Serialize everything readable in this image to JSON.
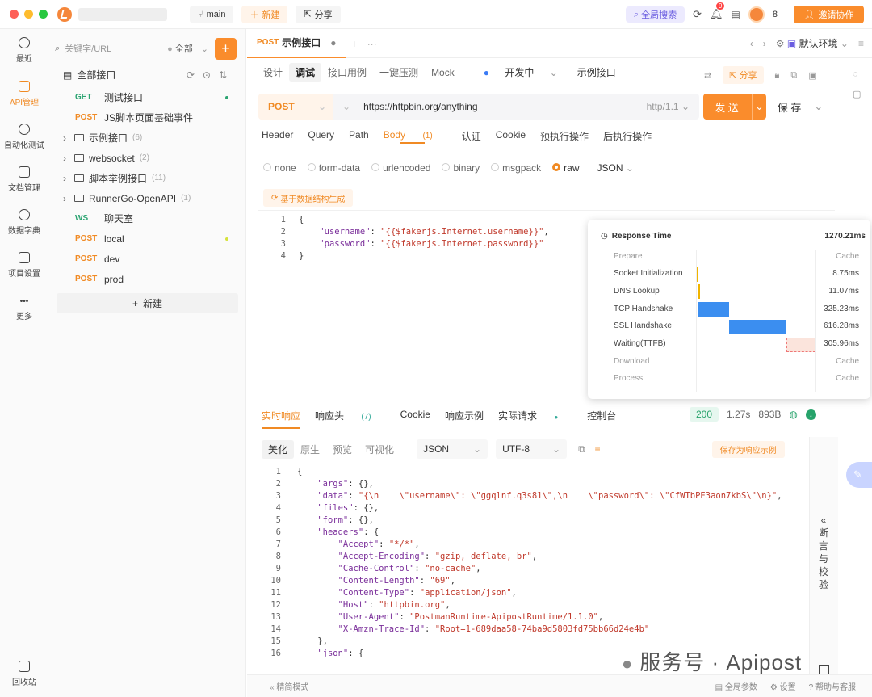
{
  "topbar": {
    "branch": "main",
    "new": "新建",
    "share": "分享",
    "global_search": "全局搜索",
    "notif_count": "9",
    "member_count": "8",
    "invite": "邀请协作"
  },
  "rail": [
    {
      "label": "最近",
      "icon": "clock-icon"
    },
    {
      "label": "API管理",
      "icon": "api-icon"
    },
    {
      "label": "自动化测试",
      "icon": "automation-icon"
    },
    {
      "label": "文档管理",
      "icon": "doc-icon"
    },
    {
      "label": "数据字典",
      "icon": "dictionary-icon"
    },
    {
      "label": "项目设置",
      "icon": "settings-icon"
    },
    {
      "label": "更多",
      "icon": "more-icon"
    },
    {
      "label": "回收站",
      "icon": "trash-icon"
    }
  ],
  "tree": {
    "search_placeholder": "关键字/URL",
    "filter": "全部",
    "root": "全部接口",
    "add": "新建",
    "items": [
      {
        "method": "GET",
        "name": "测试接口"
      },
      {
        "method": "POST",
        "name": "JS脚本页面基础事件"
      },
      {
        "folder": true,
        "name": "示例接口",
        "count": "(6)"
      },
      {
        "folder": true,
        "name": "websocket",
        "count": "(2)"
      },
      {
        "folder": true,
        "name": "脚本举例接口",
        "count": "(11)"
      },
      {
        "folder": true,
        "name": "RunnerGo-OpenAPI",
        "count": "(1)"
      },
      {
        "method": "WS",
        "name": "聊天室"
      },
      {
        "method": "POST",
        "name": "local"
      },
      {
        "method": "POST",
        "name": "dev"
      },
      {
        "method": "POST",
        "name": "prod"
      }
    ]
  },
  "tab": {
    "method": "POST",
    "title": "示例接口",
    "env": "默认环境"
  },
  "subtabs": [
    "设计",
    "调试",
    "接口用例",
    "一键压测",
    "Mock"
  ],
  "status": "开发中",
  "api_name": "示例接口",
  "share": "分享",
  "request": {
    "method": "POST",
    "url": "https://httpbin.org/anything",
    "protocol": "http/1.1",
    "send": "发 送",
    "save": "保 存"
  },
  "param_tabs": [
    "Header",
    "Query",
    "Path",
    "Body",
    "认证",
    "Cookie",
    "预执行操作",
    "后执行操作"
  ],
  "body_count": "(1)",
  "body_types": [
    "none",
    "form-data",
    "urlencoded",
    "binary",
    "msgpack",
    "raw"
  ],
  "raw_format": "JSON",
  "gen_label": "基于数据结构生成",
  "body_lines": [
    "{",
    "    \"username\": \"{{$fakerjs.Internet.username}}\",",
    "    \"password\": \"{{$fakerjs.Internet.password}}\"",
    "}"
  ],
  "response_time": {
    "title": "Response Time",
    "total": "1270.21ms",
    "rows": [
      {
        "label": "Prepare",
        "value": "Cache"
      },
      {
        "label": "Socket Initialization",
        "value": "8.75ms"
      },
      {
        "label": "DNS Lookup",
        "value": "11.07ms"
      },
      {
        "label": "TCP Handshake",
        "value": "325.23ms"
      },
      {
        "label": "SSL Handshake",
        "value": "616.28ms"
      },
      {
        "label": "Waiting(TTFB)",
        "value": "305.96ms"
      },
      {
        "label": "Download",
        "value": "Cache"
      },
      {
        "label": "Process",
        "value": "Cache"
      }
    ]
  },
  "resp_tabs": [
    "实时响应",
    "响应头",
    "Cookie",
    "响应示例",
    "实际请求",
    "控制台"
  ],
  "resp_header_count": "(7)",
  "resp_status": {
    "code": "200",
    "time": "1.27s",
    "size": "893B"
  },
  "view_tabs": [
    "美化",
    "原生",
    "预览",
    "可视化"
  ],
  "resp_format": "JSON",
  "encoding": "UTF-8",
  "save_example": "保存为响应示例",
  "resp_lines": [
    "{",
    "    \"args\": {},",
    "    \"data\": \"{\\n    \\\"username\\\": \\\"ggqlnf.q3s81\\\",\\n    \\\"password\\\": \\\"CfWTbPE3aon7kbS\\\"\\n}\",",
    "    \"files\": {},",
    "    \"form\": {},",
    "    \"headers\": {",
    "        \"Accept\": \"*/*\",",
    "        \"Accept-Encoding\": \"gzip, deflate, br\",",
    "        \"Cache-Control\": \"no-cache\",",
    "        \"Content-Length\": \"69\",",
    "        \"Content-Type\": \"application/json\",",
    "        \"Host\": \"httpbin.org\",",
    "        \"User-Agent\": \"PostmanRuntime-ApipostRuntime/1.1.0\",",
    "        \"X-Amzn-Trace-Id\": \"Root=1-689daa58-74ba9d5803fd75bb66d24e4b\"",
    "    },",
    "    \"json\": {"
  ],
  "assert_label": "断言与校验",
  "footer": {
    "mode": "精简模式",
    "params": "全局参数",
    "settings": "设置",
    "help": "帮助与客服"
  },
  "watermark": "服务号 · Apipost"
}
